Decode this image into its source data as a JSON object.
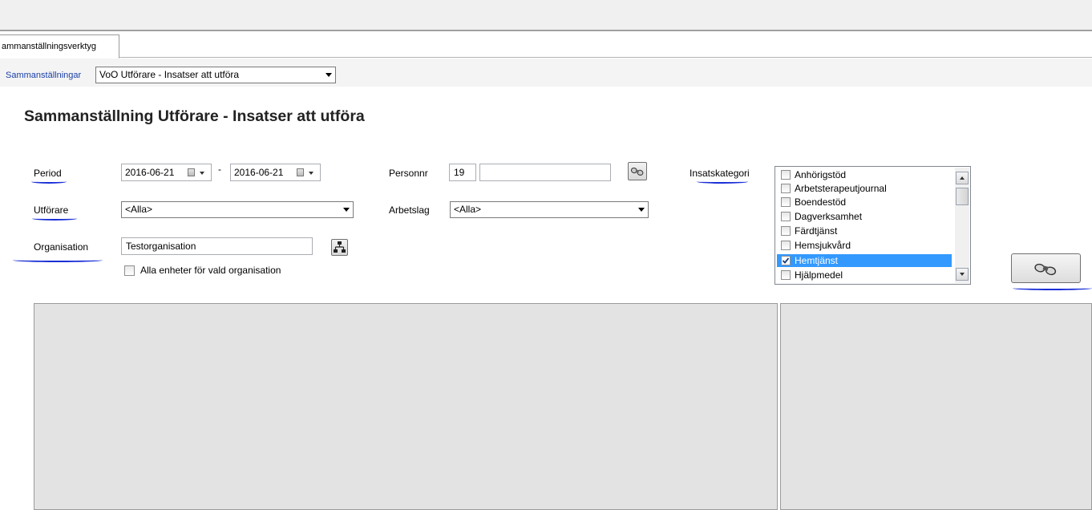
{
  "tabs": [
    {
      "label": "ammanställningsverktyg"
    }
  ],
  "toolbar": {
    "label": "Sammanställningar",
    "selected": "VoO Utförare - Insatser att utföra"
  },
  "page_title": "Sammanställning Utförare - Insatser att utföra",
  "form": {
    "period": {
      "label": "Period",
      "from": "2016-06-21",
      "separator": "-",
      "to": "2016-06-21"
    },
    "utforare": {
      "label": "Utförare",
      "value": "<Alla>"
    },
    "organisation": {
      "label": "Organisation",
      "value": "Testorganisation",
      "checkbox_label": "Alla enheter för vald organisation",
      "checked": false
    },
    "personnr": {
      "label": "Personnr",
      "prefix": "19",
      "value": ""
    },
    "arbetslag": {
      "label": "Arbetslag",
      "value": "<Alla>"
    },
    "insatskategori": {
      "label": "Insatskategori",
      "items": [
        {
          "label": "Anhörigstöd",
          "checked": false,
          "selected": false
        },
        {
          "label": "Arbetsterapeutjournal",
          "checked": false,
          "selected": false
        },
        {
          "label": "Boendestöd",
          "checked": false,
          "selected": false
        },
        {
          "label": "Dagverksamhet",
          "checked": false,
          "selected": false
        },
        {
          "label": "Färdtjänst",
          "checked": false,
          "selected": false
        },
        {
          "label": "Hemsjukvård",
          "checked": false,
          "selected": false
        },
        {
          "label": "Hemtjänst",
          "checked": true,
          "selected": true
        },
        {
          "label": "Hjälpmedel",
          "checked": false,
          "selected": false
        }
      ]
    }
  },
  "icons": {
    "search": "binoculars-icon",
    "organisation_picker": "org-tree-icon"
  },
  "colors": {
    "annotation": "#1a2fd6",
    "selection": "#3399ff",
    "toolbar_label": "#1a3fa8",
    "panel": "#e3e3e3"
  }
}
